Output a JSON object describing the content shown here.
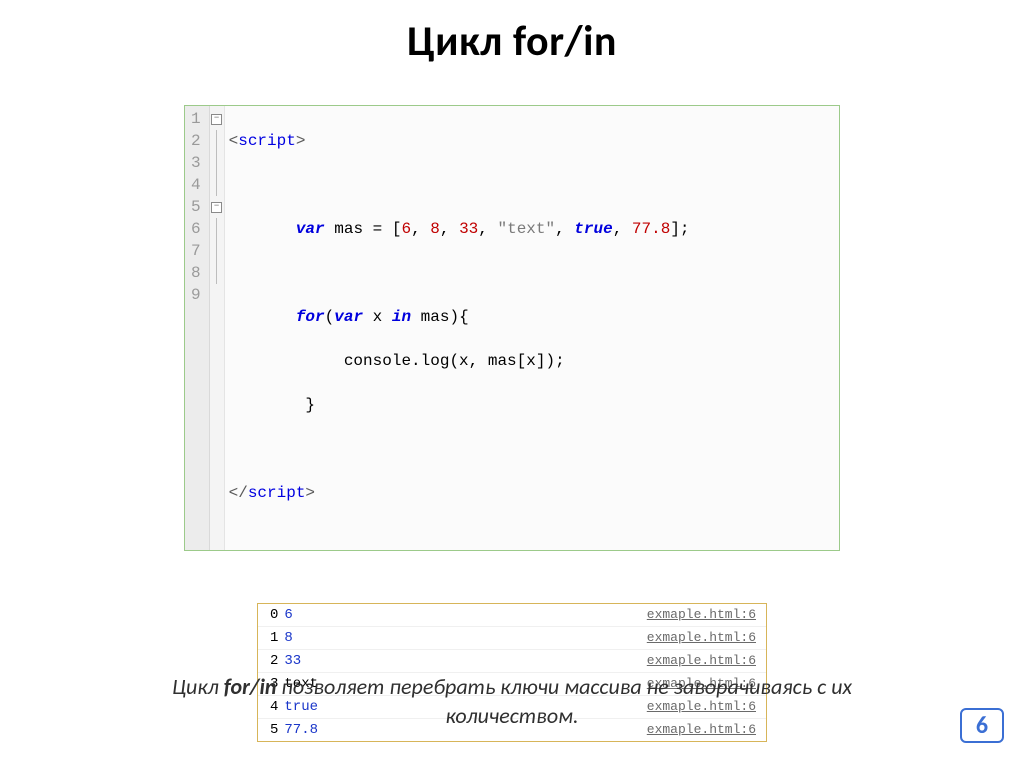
{
  "title": "Цикл for/in",
  "code": {
    "line_numbers": [
      "1",
      "2",
      "3",
      "4",
      "5",
      "6",
      "7",
      "8",
      "9"
    ],
    "l1_open_bracket": "<",
    "l1_tag": "script",
    "l1_close_bracket": ">",
    "l3_var": "var",
    "l3_ident": " mas = [",
    "l3_n1": "6",
    "l3_c": ", ",
    "l3_n2": "8",
    "l3_n3": "33",
    "l3_str": "\"text\"",
    "l3_bool": "true",
    "l3_n4": "77.8",
    "l3_end": "];",
    "l5_for": "for",
    "l5_open": "(",
    "l5_var": "var",
    "l5_x": " x ",
    "l5_in": "in",
    "l5_rest": " mas){",
    "l6": "            console.log(x, mas[x]);",
    "l7": "        }",
    "l9_open_bracket": "</",
    "l9_tag": "script",
    "l9_close_bracket": ">"
  },
  "console": [
    {
      "key": "0",
      "val": "6",
      "numeric": true,
      "src": "exmaple.html:6"
    },
    {
      "key": "1",
      "val": "8",
      "numeric": true,
      "src": "exmaple.html:6"
    },
    {
      "key": "2",
      "val": "33",
      "numeric": true,
      "src": "exmaple.html:6"
    },
    {
      "key": "3",
      "val": "text",
      "numeric": false,
      "src": "exmaple.html:6"
    },
    {
      "key": "4",
      "val": "true",
      "numeric": true,
      "src": "exmaple.html:6"
    },
    {
      "key": "5",
      "val": "77.8",
      "numeric": true,
      "src": "exmaple.html:6"
    }
  ],
  "caption_prefix": "Цикл ",
  "caption_bold": "for/in",
  "caption_rest_line1": " позволяет перебрать ключи массива не заворачиваясь с их",
  "caption_line2": "количеством.",
  "page_number": "6"
}
